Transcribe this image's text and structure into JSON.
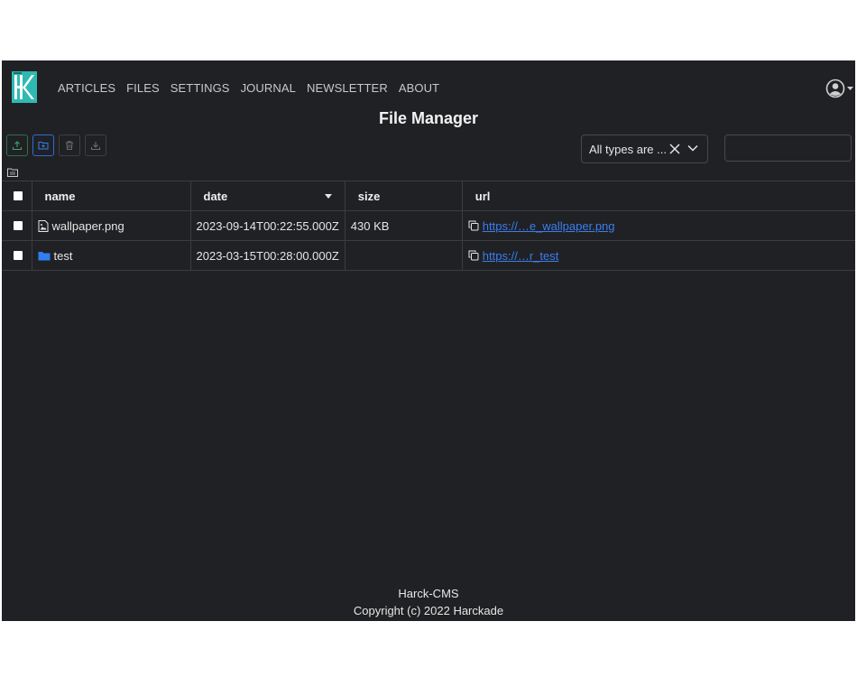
{
  "nav": {
    "links": [
      "ARTICLES",
      "FILES",
      "SETTINGS",
      "JOURNAL",
      "NEWSLETTER",
      "ABOUT"
    ]
  },
  "page": {
    "title": "File Manager"
  },
  "toolbar": {
    "buttons": [
      "upload-icon",
      "new-folder-icon",
      "trash-icon",
      "download-icon"
    ]
  },
  "filter": {
    "selected": "All types are ..."
  },
  "search": {
    "value": "",
    "placeholder": ""
  },
  "table": {
    "columns": [
      "name",
      "date",
      "size",
      "url"
    ],
    "rows": [
      {
        "icon": "image-file-icon",
        "name": "wallpaper.png",
        "date": "2023-09-14T00:22:55.000Z",
        "size": "430 KB",
        "url": "https://…e_wallpaper.png"
      },
      {
        "icon": "folder-icon",
        "name": "test",
        "date": "2023-03-15T00:28:00.000Z",
        "size": "",
        "url": "https://…r_test"
      }
    ]
  },
  "footer": {
    "line1": "Harck-CMS",
    "line2": "Copyright (c) 2022 Harckade"
  },
  "colors": {
    "background": "#202124",
    "link": "#3b7df0",
    "accent_green": "#2f6f4a",
    "accent_blue": "#2f6bd6",
    "logo_teal": "#2fb9b2"
  }
}
